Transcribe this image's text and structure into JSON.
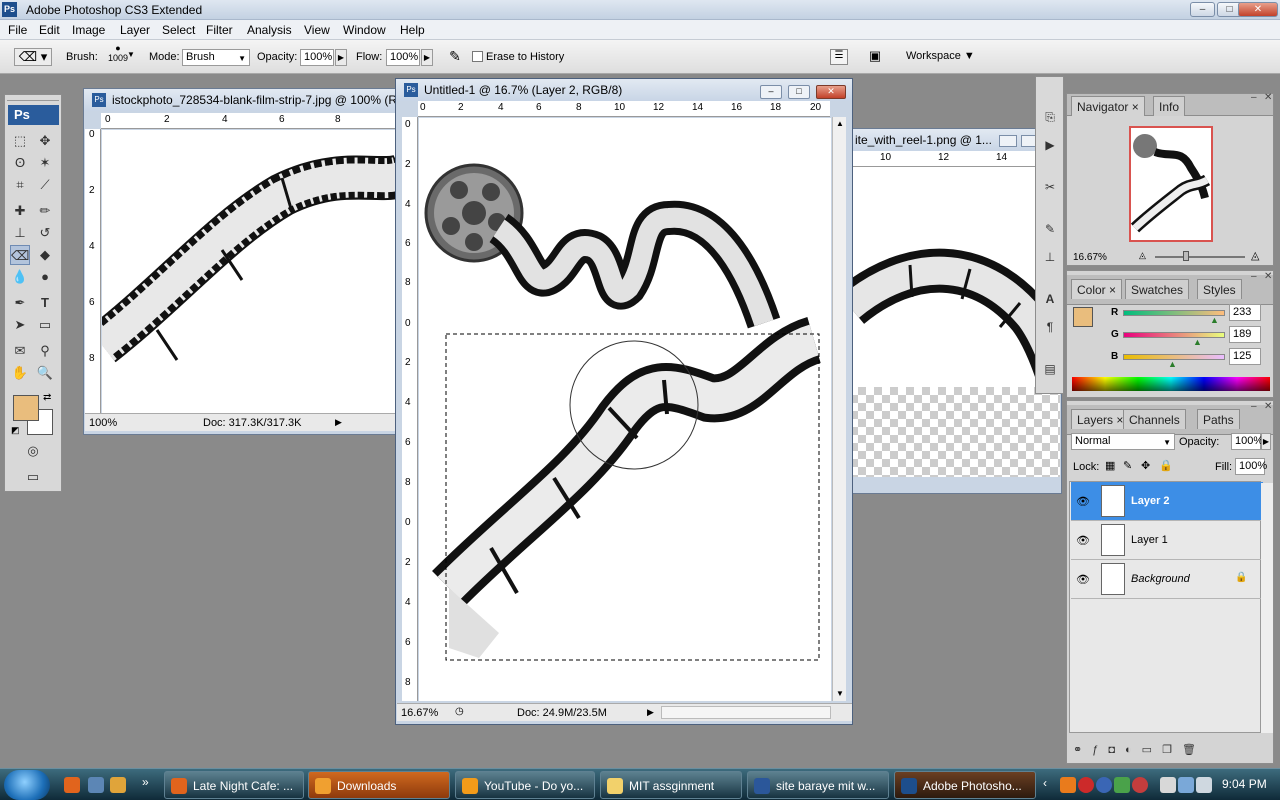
{
  "app": {
    "title": "Adobe Photoshop CS3 Extended",
    "logo": "Ps"
  },
  "window_controls": {
    "minimize": "–",
    "maximize": "□",
    "close": "✕"
  },
  "menu": [
    "File",
    "Edit",
    "Image",
    "Layer",
    "Select",
    "Filter",
    "Analysis",
    "View",
    "Window",
    "Help"
  ],
  "options": {
    "brush_label": "Brush:",
    "brush_size": "1009",
    "mode_label": "Mode:",
    "mode_value": "Brush",
    "opacity_label": "Opacity:",
    "opacity_value": "100%",
    "flow_label": "Flow:",
    "flow_value": "100%",
    "erase_history": "Erase to History",
    "workspace": "Workspace ▼"
  },
  "toolbox": {
    "badge": "Ps",
    "foreground_color": "#E9BD7D",
    "background_color": "#FFFFFF"
  },
  "doc_left": {
    "title": "istockphoto_728534-blank-film-strip-7.jpg @ 100% (R",
    "ruler_h": [
      "0",
      "2",
      "4",
      "6",
      "8"
    ],
    "ruler_v": [
      "0",
      "2",
      "4",
      "6",
      "8"
    ],
    "zoom": "100%",
    "doc_size": "Doc: 317.3K/317.3K"
  },
  "doc_main": {
    "title": "Untitled-1 @ 16.7% (Layer 2, RGB/8)",
    "ruler_h": [
      "0",
      "2",
      "4",
      "6",
      "8",
      "10",
      "12",
      "14",
      "16",
      "18",
      "20"
    ],
    "ruler_v": [
      "0",
      "2",
      "4",
      "6",
      "8",
      "0",
      "2",
      "4",
      "6",
      "8",
      "0",
      "2",
      "4",
      "6",
      "8"
    ],
    "zoom": "16.67%",
    "doc_size": "Doc: 24.9M/23.5M"
  },
  "doc_right": {
    "title": "ite_with_reel-1.png @ 1...",
    "ruler_h": [
      "10",
      "12",
      "14"
    ]
  },
  "navigator": {
    "tabs": [
      "Navigator",
      "Info"
    ],
    "zoom": "16.67%"
  },
  "color": {
    "tabs": [
      "Color",
      "Swatches",
      "Styles"
    ],
    "channels": [
      {
        "label": "R",
        "value": "233"
      },
      {
        "label": "G",
        "value": "189"
      },
      {
        "label": "B",
        "value": "125"
      }
    ],
    "swatch": "#E9BD7D"
  },
  "layers": {
    "tabs": [
      "Layers",
      "Channels",
      "Paths"
    ],
    "blend_mode": "Normal",
    "opacity_label": "Opacity:",
    "opacity_value": "100%",
    "lock_label": "Lock:",
    "fill_label": "Fill:",
    "fill_value": "100%",
    "items": [
      {
        "name": "Layer 2"
      },
      {
        "name": "Layer 1"
      },
      {
        "name": "Background"
      }
    ]
  },
  "taskbar": {
    "tasks": [
      {
        "label": "Late Night Cafe: ..."
      },
      {
        "label": "Downloads"
      },
      {
        "label": "YouTube - Do yo..."
      },
      {
        "label": "MIT  assginment"
      },
      {
        "label": "site baraye mit w..."
      },
      {
        "label": "Adobe Photosho..."
      }
    ],
    "clock": "9:04 PM"
  }
}
